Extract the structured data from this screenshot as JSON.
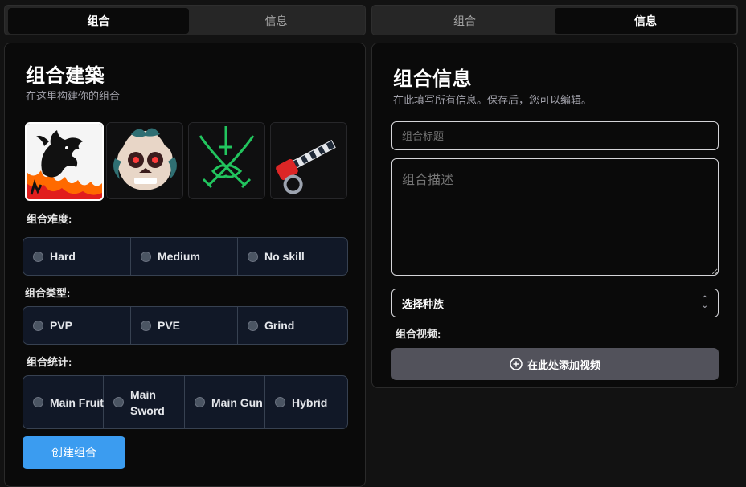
{
  "left_tabs": {
    "tab1": "组合",
    "tab2": "信息"
  },
  "right_tabs": {
    "tab1": "组合",
    "tab2": "信息"
  },
  "builder": {
    "title": "组合建築",
    "subtitle": "在这里构建你的组合",
    "icons": [
      "dragon-icon",
      "skull-icon",
      "crossed-swords-icon",
      "gun-icon"
    ],
    "difficulty_label": "组合难度:",
    "difficulty_options": [
      "Hard",
      "Medium",
      "No skill"
    ],
    "type_label": "组合类型:",
    "type_options": [
      "PVP",
      "PVE",
      "Grind"
    ],
    "stats_label": "组合统计:",
    "stats_options": [
      "Main Fruit",
      "Main Sword",
      "Main Gun",
      "Hybrid"
    ],
    "create_button": "创建组合"
  },
  "info": {
    "title": "组合信息",
    "subtitle": "在此填写所有信息。保存后，您可以编辑。",
    "title_placeholder": "组合标题",
    "desc_placeholder": "组合描述",
    "race_select": "选择种族",
    "video_label": "组合视频:",
    "video_button": "在此处添加视频"
  },
  "colors": {
    "accent": "#3b9cf0",
    "option_bg": "#111827",
    "video_btn": "#52525b"
  }
}
